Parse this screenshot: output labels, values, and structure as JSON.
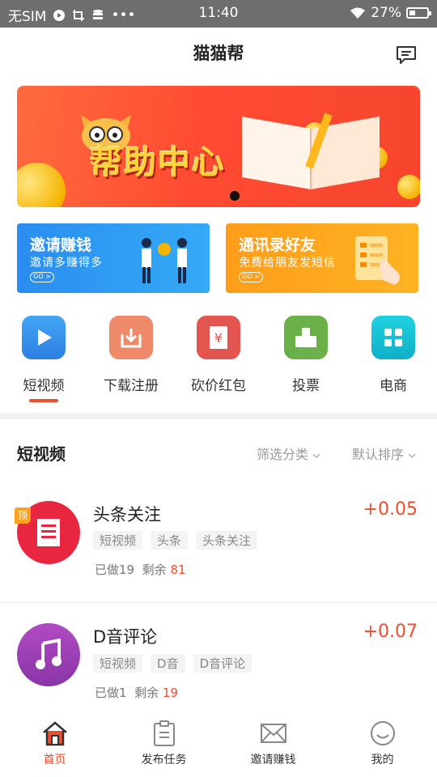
{
  "status_bar": {
    "carrier": "无SIM",
    "time": "11:40",
    "battery": "27%"
  },
  "header": {
    "title": "猫猫帮"
  },
  "banner": {
    "title": "帮助中心"
  },
  "promos": [
    {
      "title": "邀请赚钱",
      "subtitle": "邀请多赚得多",
      "go": "GO >"
    },
    {
      "title": "通讯录好友",
      "subtitle": "免费给朋友发短信",
      "go": "GO >"
    }
  ],
  "categories": [
    {
      "label": "短视频",
      "icon": "play-icon",
      "color": "#2f8ee8"
    },
    {
      "label": "下载注册",
      "icon": "download-icon",
      "color": "#ee8a6a"
    },
    {
      "label": "砍价红包",
      "icon": "red-envelope-icon",
      "color": "#e2564f"
    },
    {
      "label": "投票",
      "icon": "ballot-box-icon",
      "color": "#6bb14a"
    },
    {
      "label": "电商",
      "icon": "grid-icon",
      "color": "#13bfd5"
    }
  ],
  "section": {
    "title": "短视频",
    "filter_label": "筛选分类",
    "sort_label": "默认排序"
  },
  "tasks": [
    {
      "badge": "顶",
      "name": "头条关注",
      "price": "+0.05",
      "tags": [
        "短视频",
        "头条",
        "头条关注"
      ],
      "done_label": "已做19",
      "remain_label": "剩余",
      "remain_value": "81",
      "icon": "document-icon",
      "color": "#e8263f"
    },
    {
      "name": "D音评论",
      "price": "+0.07",
      "tags": [
        "短视频",
        "D音",
        "D音评论"
      ],
      "done_label": "已做1",
      "remain_label": "剩余",
      "remain_value": "19",
      "icon": "music-note-icon",
      "color": "#9b3fb0"
    }
  ],
  "tabbar": [
    {
      "label": "首页",
      "icon": "home-icon",
      "active": true
    },
    {
      "label": "发布任务",
      "icon": "clipboard-icon"
    },
    {
      "label": "邀请赚钱",
      "icon": "envelope-icon"
    },
    {
      "label": "我的",
      "icon": "smiley-icon"
    }
  ]
}
